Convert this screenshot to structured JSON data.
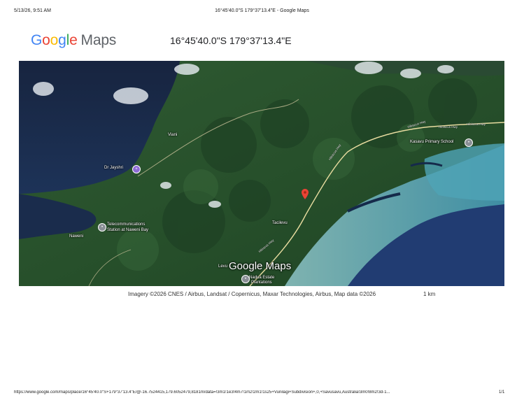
{
  "header": {
    "datetime": "5/13/26, 9:51 AM",
    "title": "16°45'40.0\"S 179°37'13.4\"E - Google Maps"
  },
  "logo": {
    "text": "Google Maps"
  },
  "place": {
    "coordinates": "16°45'40.0\"S 179°37'13.4\"E"
  },
  "map": {
    "labels": {
      "viani": "Viani",
      "dr_jayshri": "Dr Jayshri",
      "station": "Station at Naweni Bay",
      "station_line1": "Telecommunications",
      "naweni": "Naweni",
      "tacilevu": "Tacilevu",
      "kasavu_school": "Kasavu Primary School",
      "levu": "Levu",
      "estate_line1": "Nadua Estate",
      "estate_line2": "Plantations"
    },
    "roads": {
      "hibiscus_1": "Hibiscus Hwy",
      "hibiscus_2": "Hibiscus Hwy",
      "hibiscus_3": "Hibiscus Hwy",
      "hibiscus_4": "Hibiscus Hwy",
      "hibiscus_5": "Hibiscus Hwy"
    },
    "watermark": "Google Maps",
    "pin_color": "#EA4335"
  },
  "attribution": "Imagery ©2026 CNES / Airbus, Landsat / Copernicus, Maxar Technologies, Airbus, Map data ©2026",
  "scale_label": "1 km",
  "footer": {
    "url": "https://www.google.com/maps/place/16°45'40.0\"S+179°37'13.4\"E/@-16.7524415,179.6052479,8181m/data=!3m1!1e3!4m7!1m2!2m1!1s25+Vunilagi+Subdivision+,0,+Savusavu,Australia!3m0!8m2!3d-1...",
    "page": "1/1"
  }
}
